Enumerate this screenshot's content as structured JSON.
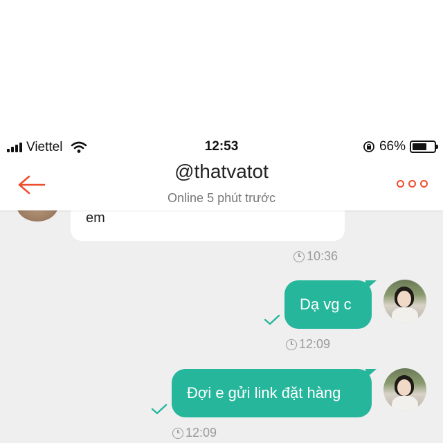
{
  "status_bar": {
    "carrier": "Viettel",
    "time": "12:53",
    "battery_percent": "66%",
    "battery_level": 0.66
  },
  "header": {
    "title": "@thatvatot",
    "subtitle": "Online 5 phút trước",
    "back_icon": "arrow-left-icon",
    "more_icon": "more-dots-icon"
  },
  "colors": {
    "accent": "#ee4d2d",
    "sent_bubble": "#26b69b",
    "chat_background": "#efefef"
  },
  "messages": [
    {
      "direction": "incoming",
      "text": "em",
      "time": "10:36"
    },
    {
      "direction": "outgoing",
      "text": "Dạ vg c",
      "time": "12:09",
      "status": "sent"
    },
    {
      "direction": "outgoing",
      "text": "Đợi e gửi link đặt hàng",
      "time": "12:09",
      "status": "sent"
    }
  ]
}
